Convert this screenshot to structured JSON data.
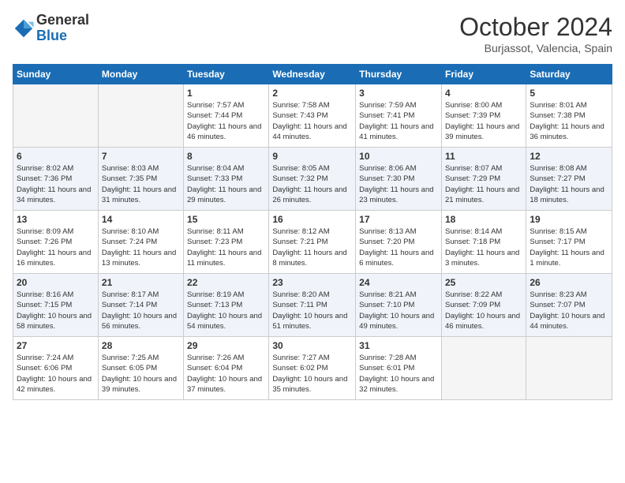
{
  "header": {
    "logo_general": "General",
    "logo_blue": "Blue",
    "month": "October 2024",
    "location": "Burjassot, Valencia, Spain"
  },
  "weekdays": [
    "Sunday",
    "Monday",
    "Tuesday",
    "Wednesday",
    "Thursday",
    "Friday",
    "Saturday"
  ],
  "weeks": [
    [
      {
        "day": "",
        "info": ""
      },
      {
        "day": "",
        "info": ""
      },
      {
        "day": "1",
        "info": "Sunrise: 7:57 AM\nSunset: 7:44 PM\nDaylight: 11 hours\nand 46 minutes."
      },
      {
        "day": "2",
        "info": "Sunrise: 7:58 AM\nSunset: 7:43 PM\nDaylight: 11 hours\nand 44 minutes."
      },
      {
        "day": "3",
        "info": "Sunrise: 7:59 AM\nSunset: 7:41 PM\nDaylight: 11 hours\nand 41 minutes."
      },
      {
        "day": "4",
        "info": "Sunrise: 8:00 AM\nSunset: 7:39 PM\nDaylight: 11 hours\nand 39 minutes."
      },
      {
        "day": "5",
        "info": "Sunrise: 8:01 AM\nSunset: 7:38 PM\nDaylight: 11 hours\nand 36 minutes."
      }
    ],
    [
      {
        "day": "6",
        "info": "Sunrise: 8:02 AM\nSunset: 7:36 PM\nDaylight: 11 hours\nand 34 minutes."
      },
      {
        "day": "7",
        "info": "Sunrise: 8:03 AM\nSunset: 7:35 PM\nDaylight: 11 hours\nand 31 minutes."
      },
      {
        "day": "8",
        "info": "Sunrise: 8:04 AM\nSunset: 7:33 PM\nDaylight: 11 hours\nand 29 minutes."
      },
      {
        "day": "9",
        "info": "Sunrise: 8:05 AM\nSunset: 7:32 PM\nDaylight: 11 hours\nand 26 minutes."
      },
      {
        "day": "10",
        "info": "Sunrise: 8:06 AM\nSunset: 7:30 PM\nDaylight: 11 hours\nand 23 minutes."
      },
      {
        "day": "11",
        "info": "Sunrise: 8:07 AM\nSunset: 7:29 PM\nDaylight: 11 hours\nand 21 minutes."
      },
      {
        "day": "12",
        "info": "Sunrise: 8:08 AM\nSunset: 7:27 PM\nDaylight: 11 hours\nand 18 minutes."
      }
    ],
    [
      {
        "day": "13",
        "info": "Sunrise: 8:09 AM\nSunset: 7:26 PM\nDaylight: 11 hours\nand 16 minutes."
      },
      {
        "day": "14",
        "info": "Sunrise: 8:10 AM\nSunset: 7:24 PM\nDaylight: 11 hours\nand 13 minutes."
      },
      {
        "day": "15",
        "info": "Sunrise: 8:11 AM\nSunset: 7:23 PM\nDaylight: 11 hours\nand 11 minutes."
      },
      {
        "day": "16",
        "info": "Sunrise: 8:12 AM\nSunset: 7:21 PM\nDaylight: 11 hours\nand 8 minutes."
      },
      {
        "day": "17",
        "info": "Sunrise: 8:13 AM\nSunset: 7:20 PM\nDaylight: 11 hours\nand 6 minutes."
      },
      {
        "day": "18",
        "info": "Sunrise: 8:14 AM\nSunset: 7:18 PM\nDaylight: 11 hours\nand 3 minutes."
      },
      {
        "day": "19",
        "info": "Sunrise: 8:15 AM\nSunset: 7:17 PM\nDaylight: 11 hours\nand 1 minute."
      }
    ],
    [
      {
        "day": "20",
        "info": "Sunrise: 8:16 AM\nSunset: 7:15 PM\nDaylight: 10 hours\nand 58 minutes."
      },
      {
        "day": "21",
        "info": "Sunrise: 8:17 AM\nSunset: 7:14 PM\nDaylight: 10 hours\nand 56 minutes."
      },
      {
        "day": "22",
        "info": "Sunrise: 8:19 AM\nSunset: 7:13 PM\nDaylight: 10 hours\nand 54 minutes."
      },
      {
        "day": "23",
        "info": "Sunrise: 8:20 AM\nSunset: 7:11 PM\nDaylight: 10 hours\nand 51 minutes."
      },
      {
        "day": "24",
        "info": "Sunrise: 8:21 AM\nSunset: 7:10 PM\nDaylight: 10 hours\nand 49 minutes."
      },
      {
        "day": "25",
        "info": "Sunrise: 8:22 AM\nSunset: 7:09 PM\nDaylight: 10 hours\nand 46 minutes."
      },
      {
        "day": "26",
        "info": "Sunrise: 8:23 AM\nSunset: 7:07 PM\nDaylight: 10 hours\nand 44 minutes."
      }
    ],
    [
      {
        "day": "27",
        "info": "Sunrise: 7:24 AM\nSunset: 6:06 PM\nDaylight: 10 hours\nand 42 minutes."
      },
      {
        "day": "28",
        "info": "Sunrise: 7:25 AM\nSunset: 6:05 PM\nDaylight: 10 hours\nand 39 minutes."
      },
      {
        "day": "29",
        "info": "Sunrise: 7:26 AM\nSunset: 6:04 PM\nDaylight: 10 hours\nand 37 minutes."
      },
      {
        "day": "30",
        "info": "Sunrise: 7:27 AM\nSunset: 6:02 PM\nDaylight: 10 hours\nand 35 minutes."
      },
      {
        "day": "31",
        "info": "Sunrise: 7:28 AM\nSunset: 6:01 PM\nDaylight: 10 hours\nand 32 minutes."
      },
      {
        "day": "",
        "info": ""
      },
      {
        "day": "",
        "info": ""
      }
    ]
  ]
}
